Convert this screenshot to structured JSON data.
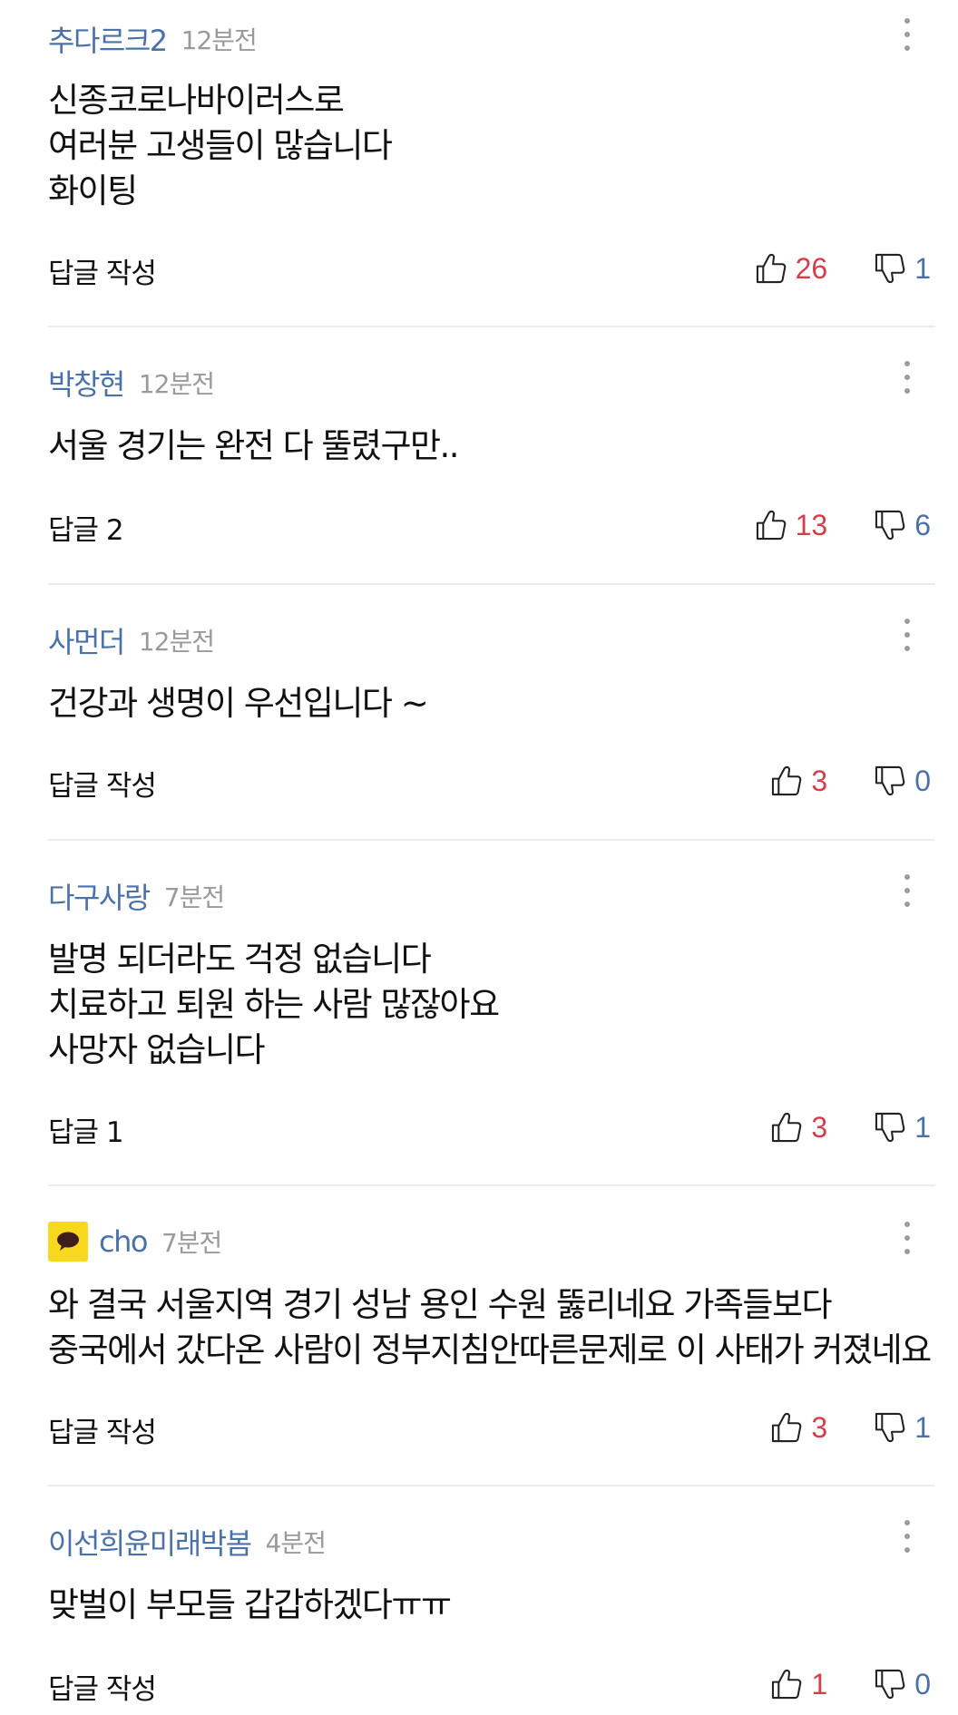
{
  "colors": {
    "author": "#4b72a8",
    "time": "#9a9a9a",
    "like_count": "#d4404a",
    "dislike_count": "#4b72a8",
    "divider": "#ececec",
    "avatar_bg": "#f8d81c"
  },
  "icons": {
    "more": "more-vertical-icon",
    "like": "thumbs-up-icon",
    "dislike": "thumbs-down-icon",
    "avatar": "kakao-speech-bubble-icon"
  },
  "comments": [
    {
      "author": "추다르크2",
      "time": "12분전",
      "text": "신종코로나바이러스로\n여러분 고생들이 많습니다\n화이팅",
      "reply": "답글 작성",
      "likes": "26",
      "dislikes": "1"
    },
    {
      "author": "박창현",
      "time": "12분전",
      "text": "서울 경기는 완전 다 뚤렸구만..",
      "reply": "답글 2",
      "likes": "13",
      "dislikes": "6"
    },
    {
      "author": "사먼더",
      "time": "12분전",
      "text": "건강과 생명이 우선입니다 ~",
      "reply": "답글 작성",
      "likes": "3",
      "dislikes": "0"
    },
    {
      "author": "다구사랑",
      "time": "7분전",
      "text": "발명 되더라도 걱정 없습니다\n치료하고 퇴원 하는 사람 많잖아요\n사망자 없습니다",
      "reply": "답글 1",
      "likes": "3",
      "dislikes": "1"
    },
    {
      "author": "cho",
      "time": "7분전",
      "text": "와 결국 서울지역 경기 성남 용인 수원 뚫리네요 가족들보다\n중국에서 갔다온 사람이 정부지침안따른문제로 이 사태가 커졌네요",
      "reply": "답글 작성",
      "likes": "3",
      "dislikes": "1"
    },
    {
      "author": "이선희윤미래박봄",
      "time": "4분전",
      "text": "맞벌이 부모들 갑갑하겠다ㅠㅠ",
      "reply": "답글 작성",
      "likes": "1",
      "dislikes": "0"
    }
  ]
}
